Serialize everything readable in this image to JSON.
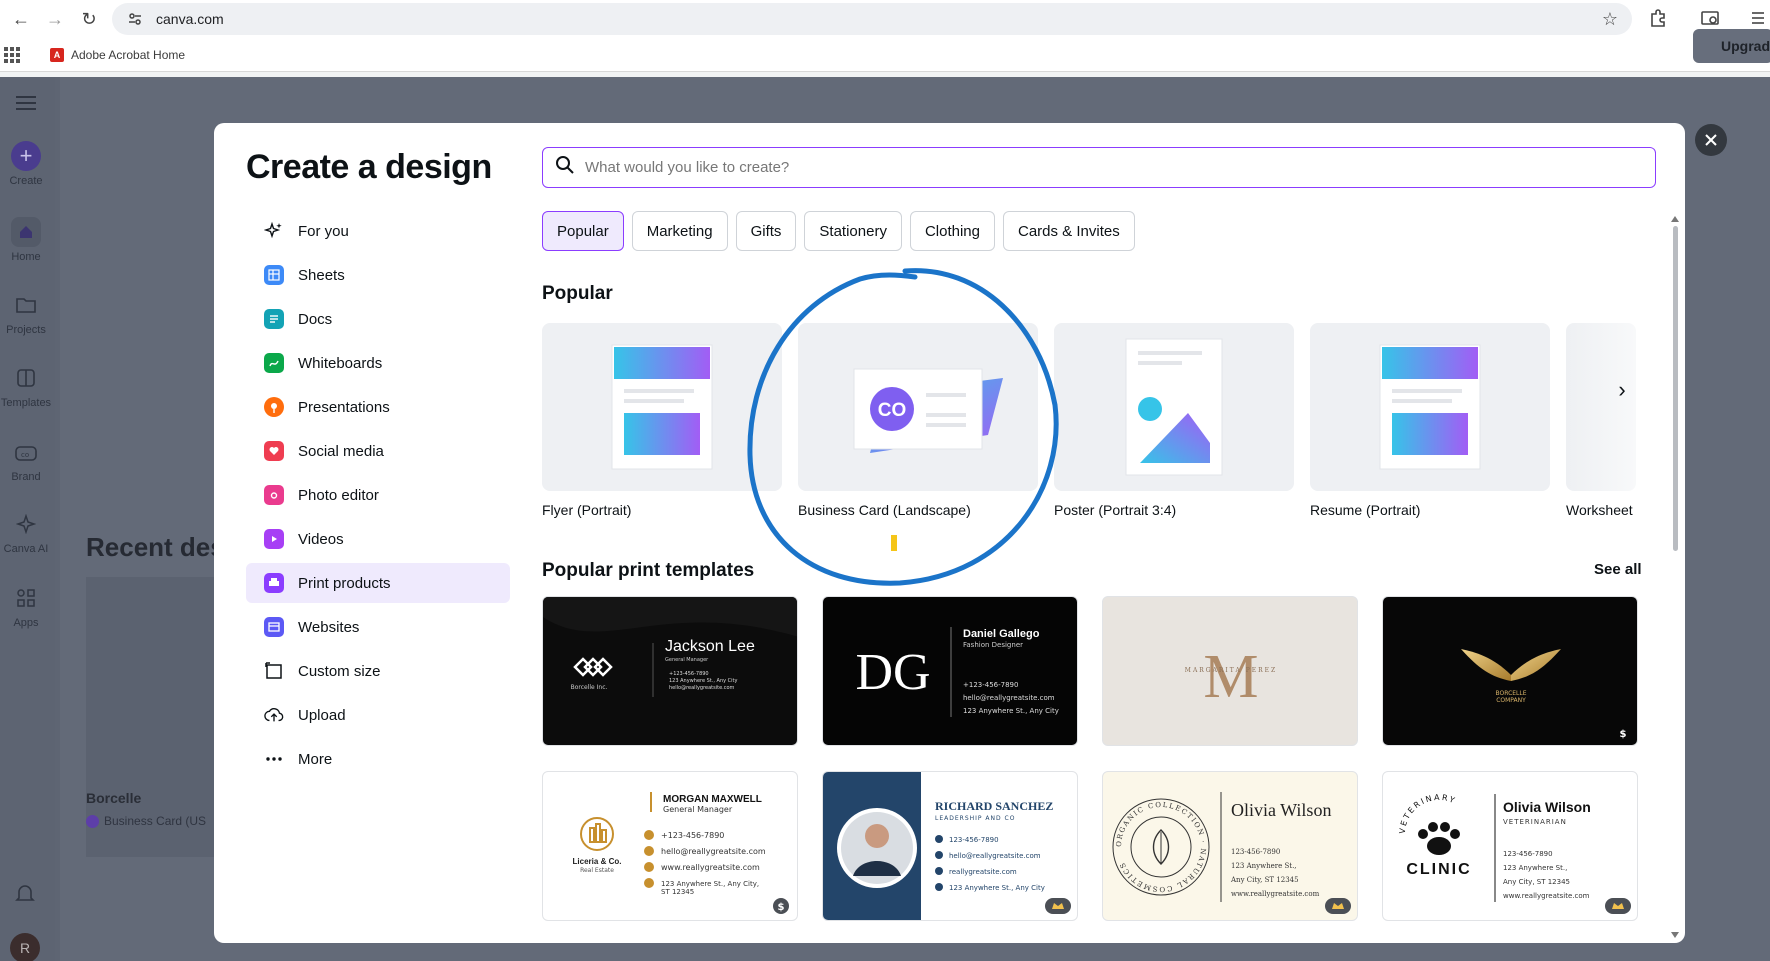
{
  "browser": {
    "url": "canva.com",
    "bookmark": "Adobe Acrobat Home"
  },
  "app": {
    "rail": [
      {
        "label": "Create",
        "icon": "plus-icon"
      },
      {
        "label": "Home",
        "icon": "home-icon"
      },
      {
        "label": "Projects",
        "icon": "folder-icon"
      },
      {
        "label": "Templates",
        "icon": "templates-icon"
      },
      {
        "label": "Brand",
        "icon": "brand-icon"
      },
      {
        "label": "Canva AI",
        "icon": "sparkle-icon"
      },
      {
        "label": "Apps",
        "icon": "apps-icon"
      }
    ],
    "recent_title": "Recent des",
    "recent_item_name": "Borcelle",
    "recent_item_sub": "Business Card (US",
    "upgrade_label": "Upgrad",
    "avatar_letter": "R"
  },
  "modal": {
    "title": "Create a design",
    "search_placeholder": "What would you like to create?",
    "menu": [
      {
        "label": "For you",
        "icon": "sparkle-icon",
        "color": "#0d1216"
      },
      {
        "label": "Sheets",
        "icon": "sheets-icon",
        "color": "#3d8af7"
      },
      {
        "label": "Docs",
        "icon": "docs-icon",
        "color": "#13a3b5"
      },
      {
        "label": "Whiteboards",
        "icon": "whiteboard-icon",
        "color": "#0ba84a"
      },
      {
        "label": "Presentations",
        "icon": "presentation-icon",
        "color": "#ff6d0d"
      },
      {
        "label": "Social media",
        "icon": "heart-icon",
        "color": "#ef3d51"
      },
      {
        "label": "Photo editor",
        "icon": "camera-icon",
        "color": "#ea3b8e"
      },
      {
        "label": "Videos",
        "icon": "video-icon",
        "color": "#a73ff5"
      },
      {
        "label": "Print products",
        "icon": "print-icon",
        "color": "#8b3dff"
      },
      {
        "label": "Websites",
        "icon": "website-icon",
        "color": "#5c59f5"
      },
      {
        "label": "Custom size",
        "icon": "custom-size-icon",
        "color": "#0d1216"
      },
      {
        "label": "Upload",
        "icon": "upload-icon",
        "color": "#0d1216"
      },
      {
        "label": "More",
        "icon": "more-icon",
        "color": "#0d1216"
      }
    ],
    "active_menu": "Print products",
    "chips": [
      "Popular",
      "Marketing",
      "Gifts",
      "Stationery",
      "Clothing",
      "Cards & Invites"
    ],
    "active_chip": "Popular",
    "popular_title": "Popular",
    "popular_items": [
      {
        "label": "Flyer (Portrait)"
      },
      {
        "label": "Business Card (Landscape)",
        "thumb_text": "CO"
      },
      {
        "label": "Poster (Portrait 3:4)"
      },
      {
        "label": "Resume (Portrait)"
      },
      {
        "label": "Worksheet"
      }
    ],
    "print_title": "Popular print templates",
    "see_all": "See all",
    "templates_row1": [
      {
        "name": "Jackson Lee",
        "role": "General Manager",
        "brand": "Borcelle Inc.",
        "lines": [
          "+123-456-7890",
          "123 Anywhere St., Any City",
          "hello@reallygreatsite.com"
        ]
      },
      {
        "name": "Daniel Gallego",
        "role": "Fashion Designer",
        "monogram": "DG",
        "lines": [
          "+123-456-7890",
          "hello@reallygreatsite.com",
          "123 Anywhere St., Any City"
        ]
      },
      {
        "monogram": "M",
        "name": "MARGARITA PEREZ"
      },
      {
        "brand": "BORCELLE",
        "brand2": "COMPANY",
        "badge": "$"
      }
    ],
    "templates_row2": [
      {
        "name": "MORGAN MAXWELL",
        "role": "General Manager",
        "brand": "Liceria & Co.",
        "brand2": "Real Estate",
        "lines": [
          "+123-456-7890",
          "hello@reallygreatsite.com",
          "www.reallygreatsite.com",
          "123 Anywhere St., Any City,",
          "ST 12345"
        ],
        "badge": "$"
      },
      {
        "name": "RICHARD SANCHEZ",
        "role": "LEADERSHIP AND CO",
        "lines": [
          "123-456-7890",
          "hello@reallygreatsite.com",
          "reallygreatsite.com",
          "123 Anywhere St., Any City"
        ],
        "badge": "crown"
      },
      {
        "name": "Olivia Wilson",
        "ring": "ORGANIC COLLECTION · NATURAL COSMETICS",
        "lines": [
          "123-456-7890",
          "123 Anywhere St.,",
          "Any City, ST 12345",
          "www.reallygreatsite.com"
        ],
        "badge": "crown"
      },
      {
        "name": "Olivia Wilson",
        "role": "VETERINARIAN",
        "brand": "CLINIC",
        "arc": "VETERINARY",
        "lines": [
          "123-456-7890",
          "123 Anywhere St.,",
          "Any City, ST 12345",
          "www.reallygreatsite.com"
        ],
        "badge": "crown"
      }
    ]
  },
  "colors": {
    "accent": "#8b3dff",
    "annotation": "#1b74c9"
  }
}
